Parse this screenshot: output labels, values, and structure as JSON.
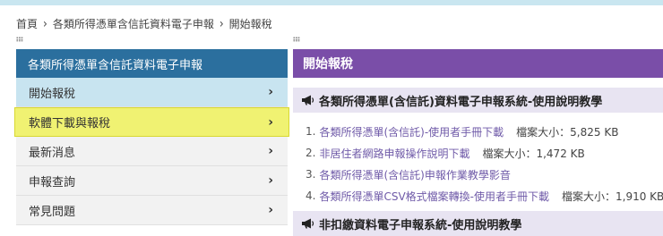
{
  "breadcrumb": {
    "items": [
      "首頁",
      "各類所得憑單含信託資料電子申報",
      "開始報稅"
    ]
  },
  "sidebar": {
    "header": "各類所得憑單含信託資料電子申報",
    "items": [
      {
        "label": "開始報稅",
        "state": "active"
      },
      {
        "label": "軟體下載與報稅",
        "state": "highlighted"
      },
      {
        "label": "最新消息",
        "state": "normal"
      },
      {
        "label": "申報查詢",
        "state": "normal"
      },
      {
        "label": "常見問題",
        "state": "normal"
      }
    ]
  },
  "main": {
    "title": "開始報稅",
    "sections": [
      {
        "heading": "各類所得憑單(含信託)資料電子申報系統-使用說明教學",
        "links": [
          {
            "num": "1.",
            "text": "各類所得憑單(含信託)-使用者手冊下載",
            "size": "檔案大小：5,825 KB"
          },
          {
            "num": "2.",
            "text": "非居住者網路申報操作說明下載",
            "size": "檔案大小：1,472 KB"
          },
          {
            "num": "3.",
            "text": "各類所得憑單(含信託)申報作業教學影音",
            "size": ""
          },
          {
            "num": "4.",
            "text": "各類所得憑單CSV格式檔案轉換-使用者手冊下載",
            "size": "檔案大小：1,910 KB"
          }
        ]
      },
      {
        "heading": "非扣繳資料電子申報系統-使用說明教學",
        "links": []
      }
    ]
  },
  "colors": {
    "sidebar_header": "#2b6f9e",
    "main_title": "#7a4ea8",
    "active_item": "#c8e4f0",
    "highlight_item": "#f0f272",
    "section_head": "#e8e4f2",
    "link": "#6f5aa8"
  },
  "icons": {
    "chevron": "chevron-right-icon",
    "section": "megaphone-icon",
    "breadcrumb_sep": "chevron-right-icon"
  }
}
